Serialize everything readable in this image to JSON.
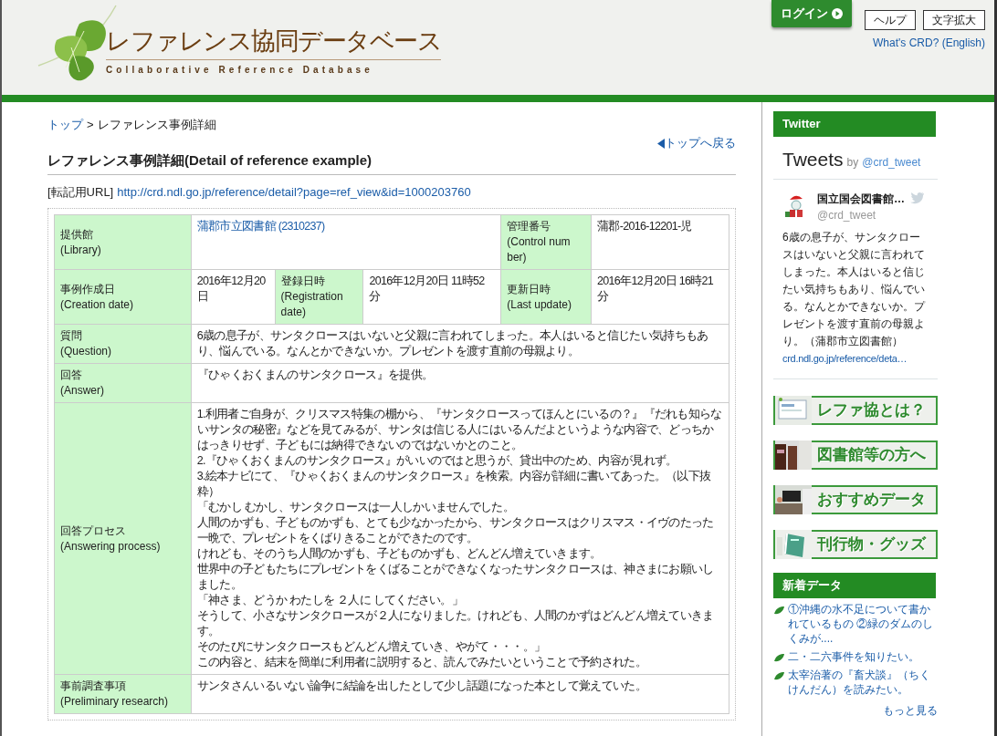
{
  "header": {
    "logo_title": "レファレンス協同データベース",
    "logo_subtitle": "Collaborative Reference Database",
    "buttons": [
      {
        "label": "ログイン",
        "kind": "primary"
      },
      {
        "label": "ヘルプ",
        "kind": "plain"
      },
      {
        "label": "文字拡大",
        "kind": "plain"
      }
    ],
    "english_link": "What's CRD? (English)"
  },
  "breadcrumb": [
    {
      "label": "トップ",
      "link": true
    },
    {
      "label": "レファレンス事例詳細",
      "link": false
    }
  ],
  "breadcrumb_separator": ">",
  "back_link": "トップへ戻る",
  "page_title": "レファレンス事例詳細(Detail of reference example)",
  "url_label": "[転記用URL]",
  "url": "http://crd.ndl.go.jp/reference/detail?page=ref_view&id=1000203760",
  "detail_rows": [
    {
      "fields": [
        {
          "label": "提供館",
          "label_en": "(Library)",
          "value": "蒲郡市立図書館 (2310237)",
          "link": true
        },
        {
          "label": "管理番号",
          "label_en": "(Control num ber)",
          "value": "蒲郡-2016-12201-児",
          "link": false
        }
      ]
    },
    {
      "fields": [
        {
          "label": "事例作成日",
          "label_en": "(Creation date)",
          "value": "2016年12月20日",
          "link": false
        },
        {
          "label": "登録日時",
          "label_en": "(Registration date)",
          "value": "2016年12月20日 11時52分",
          "link": false
        },
        {
          "label": "更新日時",
          "label_en": "(Last update)",
          "value": "2016年12月20日 16時21分",
          "link": false
        }
      ]
    },
    {
      "fields": [
        {
          "label": "質問",
          "label_en": "(Question)",
          "lines": [
            "6歳の息子が、サンタクロースはいないと父親に言われてしまった。本人はいると信じたい気持ちもあり、悩んでいる。なんとかできないか。プレゼントを渡す直前の母親より。"
          ]
        }
      ]
    },
    {
      "fields": [
        {
          "label": "回答",
          "label_en": "(Answer)",
          "lines": [
            "『ひゃくおくまんのサンタクロース』を提供。"
          ]
        }
      ]
    },
    {
      "fields": [
        {
          "label": "回答プロセス",
          "label_en": "(Answering process)",
          "lines": [
            "1.利用者ご自身が、クリスマス特集の棚から、『サンタクロースってほんとにいるの？』『だれも知らないサンタの秘密』などを見てみるが、サンタは信じる人にはいるんだよというような内容で、どっちかはっきりせず、子どもには納得できないのではないかとのこと。",
            "2.『ひゃくおくまんのサンタクロース』がいいのではと思うが、貸出中のため、内容が見れず。",
            "3.絵本ナビにて、『ひゃくおくまんのサンタクロース』を検索。内容が詳細に書いてあった。（以下抜粋）",
            "「むかし むかし、サンタクロースは一人しかいませんでした。",
            "人間のかずも、子どものかずも、とても少なかったから、サンタクロースはクリスマス・イヴのたった一晩で、プレゼントをくばりきることができたのです。",
            "けれども、そのうち人間のかずも、子どものかずも、どんどん増えていきます。",
            "世界中の子どもたちにプレゼントをくばることができなくなったサンタクロースは、神さまにお願いしました。",
            "「神さま、どうか わたしを ２人に してください。」",
            "そうして、小さなサンタクロースが２人になりました。けれども、人間のかずはどんどん増えていきます。",
            "そのたびにサンタクロースもどんどん増えていき、やがて・・・。」",
            "この内容と、結末を簡単に利用者に説明すると、読んでみたいということで予約された。"
          ]
        }
      ]
    },
    {
      "fields": [
        {
          "label": "事前調査事項",
          "label_en": "(Preliminary research)",
          "lines": [
            "サンタさんいるいない論争に結論を出したとして少し話題になった本として覚えていた。"
          ]
        }
      ]
    }
  ],
  "sidebar": {
    "twitter_header": "Twitter",
    "tweets_title": "Tweets",
    "tweets_by": "by",
    "tweets_handle": "@crd_tweet",
    "tweet": {
      "name": "国立国会図書館…",
      "handle": "@crd_tweet",
      "text": "6歳の息子が、サンタクロースはいないと父親に言われてしまった。本人はいると信じたい気持ちもあり、悩んでいる。なんとかできないか。プレゼントを渡す直前の母親より。（蒲郡市立図書館）",
      "link": "crd.ndl.go.jp/reference/deta…"
    },
    "banners": [
      {
        "label": "レファ協とは？",
        "kind": "screen"
      },
      {
        "label": "図書館等の方へ",
        "kind": "room"
      },
      {
        "label": "おすすめデータ",
        "kind": "desk"
      },
      {
        "label": "刊行物・グッズ",
        "kind": "book"
      }
    ],
    "new_data_header": "新着データ",
    "new_data": [
      "①沖縄の水不足について書かれているもの ②緑のダムのしくみが....",
      "二・二六事件を知りたい。",
      "太宰治著の『畜犬談』（ちくけんだん）を読みたい。"
    ],
    "more_link": "もっと見る"
  }
}
